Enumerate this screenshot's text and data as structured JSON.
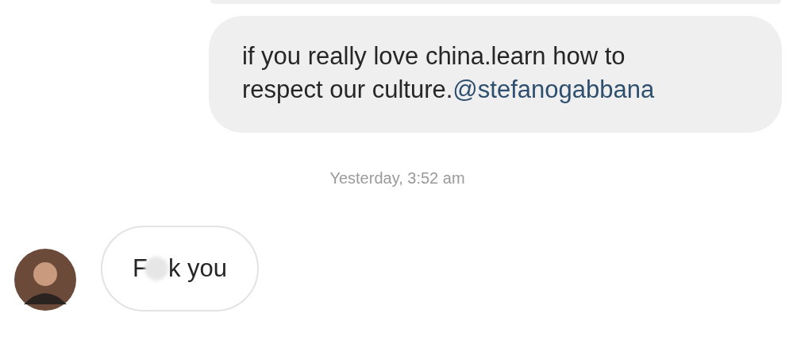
{
  "messages": [
    {
      "kind": "sent_partial"
    },
    {
      "kind": "sent",
      "text": "if you really love china.learn how to respect our culture.",
      "mention": "@stefanogabbana"
    },
    {
      "kind": "timestamp",
      "text": "Yesterday, 3:52 am"
    },
    {
      "kind": "received",
      "text_start": "F",
      "censored": true,
      "text_end": "k you"
    }
  ]
}
